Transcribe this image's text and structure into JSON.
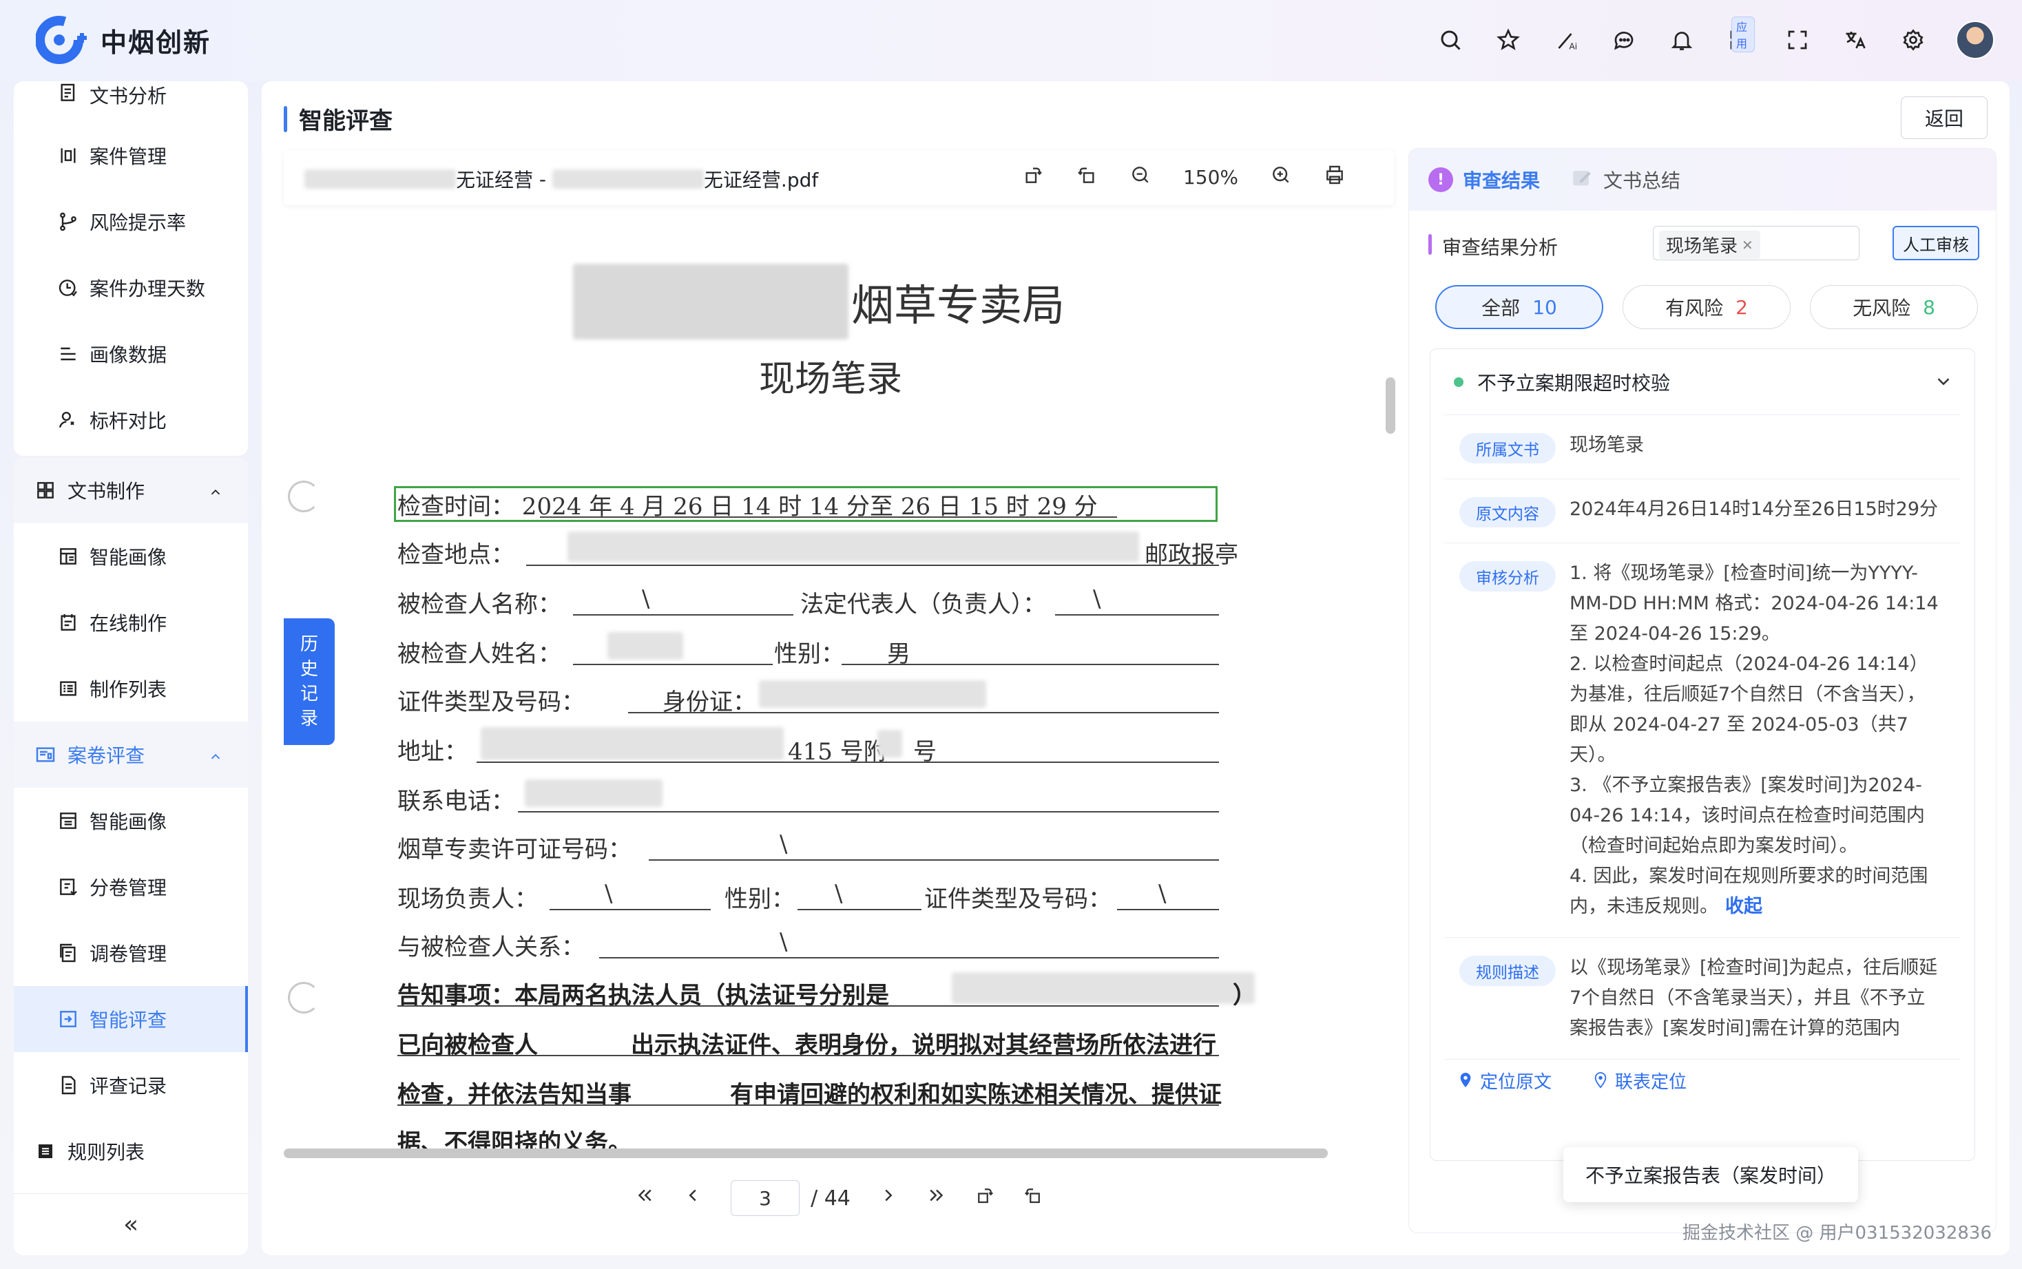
{
  "brand": {
    "name": "中烟创新"
  },
  "topbar": {
    "icons": [
      "search-icon",
      "star-icon",
      "ai-magic-icon",
      "chat-icon",
      "bell-icon",
      "apps-icon",
      "fullscreen-icon",
      "translate-icon",
      "settings-icon"
    ],
    "apps_badge": "应用"
  },
  "sidebar": {
    "items_top": [
      {
        "label": "文书分析",
        "icon": "document-icon"
      },
      {
        "label": "案件管理",
        "icon": "case-icon"
      },
      {
        "label": "风险提示率",
        "icon": "branch-icon"
      },
      {
        "label": "案件办理天数",
        "icon": "clock-icon"
      },
      {
        "label": "画像数据",
        "icon": "list-icon"
      },
      {
        "label": "标杆对比",
        "icon": "user-compare-icon"
      }
    ],
    "group1": {
      "label": "文书制作",
      "icon": "grid-icon"
    },
    "group1_items": [
      {
        "label": "智能画像",
        "icon": "layout-icon"
      },
      {
        "label": "在线制作",
        "icon": "edit-doc-icon"
      },
      {
        "label": "制作列表",
        "icon": "table-icon"
      }
    ],
    "group2": {
      "label": "案卷评查",
      "icon": "archive-icon"
    },
    "group2_items": [
      {
        "label": "智能画像",
        "icon": "layout-icon"
      },
      {
        "label": "分卷管理",
        "icon": "split-icon"
      },
      {
        "label": "调卷管理",
        "icon": "copy-icon"
      },
      {
        "label": "智能评查",
        "icon": "check-doc-icon",
        "active": true
      },
      {
        "label": "评查记录",
        "icon": "record-icon"
      }
    ],
    "bottom_item": {
      "label": "规则列表",
      "icon": "rules-icon"
    },
    "collapse": "«"
  },
  "main": {
    "title": "智能评查",
    "back": "返回"
  },
  "viewer": {
    "file_left": "无证经营",
    "file_sep": " - ",
    "file_right": "无证经营.pdf",
    "zoom": "150%",
    "history": [
      "历",
      "史",
      "记",
      "录"
    ],
    "page_current": "3",
    "page_total": "/ 44"
  },
  "document": {
    "org_suffix": "烟草专卖局",
    "doc_title": "现场笔录",
    "line_time": "检查时间：  2024    年 4 月    26 日    14    时  14 分至    26    日  15 时  29    分",
    "line_place": "检查地点：",
    "place_suffix": "邮政报亭",
    "line_inspectee": "被检查人名称：",
    "inspectee_val": "\\",
    "legal_rep": "法定代表人（负责人）：",
    "legal_val": "\\",
    "line_name": "被检查人姓名：",
    "gender_label": "性别：",
    "gender_val": "男",
    "line_id": "证件类型及号码：",
    "id_type": "身份证：",
    "line_addr": "地址：",
    "addr_mid": "415 号附",
    "addr_end": "号",
    "line_phone": "联系电话：",
    "line_license": "烟草专卖许可证号码：",
    "license_val": "\\",
    "line_scene": "现场负责人：",
    "scene_val": "\\",
    "scene_gender": "性别：",
    "scene_gender_val": "\\",
    "scene_id": "证件类型及号码：",
    "scene_id_val": "\\",
    "line_rel": "与被检查人关系：",
    "rel_val": "\\",
    "notice1": "告知事项：本局两名执法人员（执法证号分别是",
    "notice1_end": "）",
    "notice2a": "已向被检查人",
    "notice2b": "出示执法证件、表明身份，说明拟对其经营场所依法进行",
    "notice3a": "检查，并依法告知当事",
    "notice3b": "有申请回避的权利和如实陈述相关情况、提供证",
    "notice4": "据、不得阻挠的义务。"
  },
  "panel": {
    "tab_active": "审查结果",
    "tab_active_badge": "!",
    "tab_other": "文书总结",
    "section_title": "审查结果分析",
    "chip": "现场笔录",
    "manual": "人工审核",
    "filters": [
      {
        "label": "全部",
        "count": "10"
      },
      {
        "label": "有风险",
        "count": "2"
      },
      {
        "label": "无风险",
        "count": "8"
      }
    ],
    "rule_title": "不予立案期限超时校验",
    "rows": [
      {
        "tag": "所属文书",
        "text": "现场笔录"
      },
      {
        "tag": "原文内容",
        "text": "2024年4月26日14时14分至26日15时29分"
      },
      {
        "tag": "审核分析",
        "text": "1. 将《现场笔录》[检查时间]统一为YYYY-MM-DD HH:MM 格式：2024-04-26 14:14 至 2024-04-26 15:29。\n2. 以检查时间起点（2024-04-26 14:14）为基准，往后顺延7个自然日（不含当天），即从 2024-04-27 至 2024-05-03（共7天）。\n3. 《不予立案报告表》[案发时间]为2024-04-26 14:14，该时间点在检查时间范围内（检查时间起始点即为案发时间）。\n4. 因此，案发时间在规则所要求的时间范围内，未违反规则。",
        "link": "收起"
      },
      {
        "tag": "规则描述",
        "text": "以《现场笔录》[检查时间]为起点，往后顺延7个自然日（不含笔录当天），并且《不予立案报告表》[案发时间]需在计算的范围内"
      }
    ],
    "locate_original": "定位原文",
    "locate_linked": "联表定位"
  },
  "tooltip": "不予立案报告表（案发时间）",
  "watermark": "掘金技术社区 @ 用户031532032836"
}
